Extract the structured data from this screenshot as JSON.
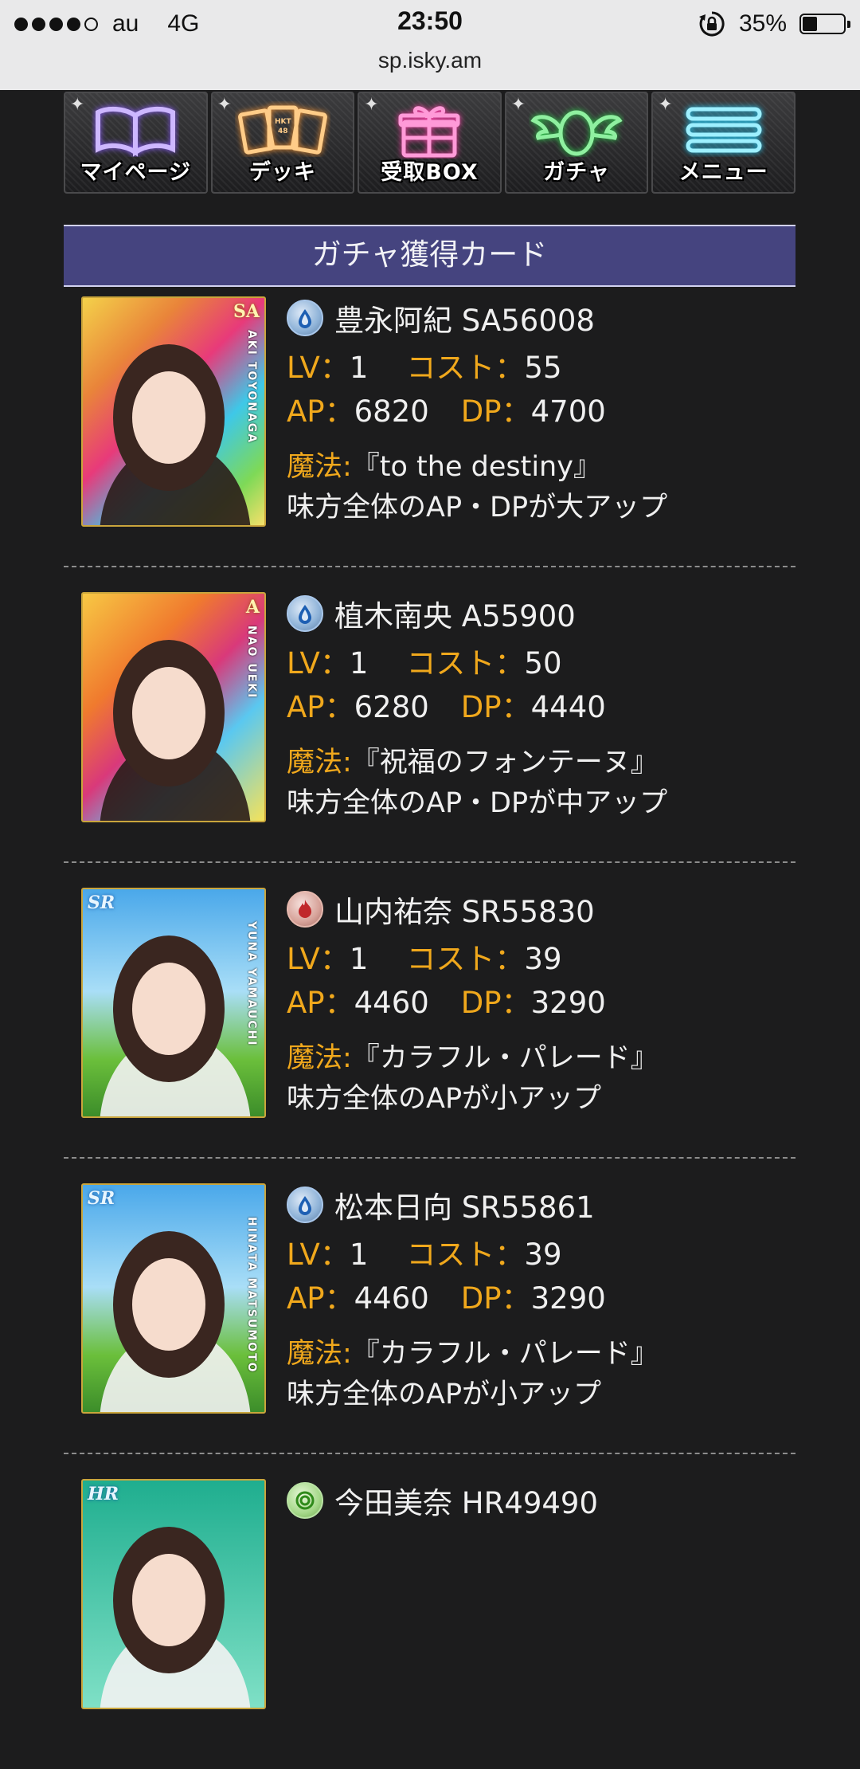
{
  "status_bar": {
    "carrier": "au",
    "network": "4G",
    "time": "23:50",
    "battery_percent": "35%",
    "battery_level": 0.35
  },
  "url_bar": {
    "url": "sp.isky.am"
  },
  "nav": [
    {
      "label": "マイページ",
      "icon": "book-icon",
      "color": "#cdb7ff"
    },
    {
      "label": "デッキ",
      "icon": "cards-icon",
      "color": "#ffcc88"
    },
    {
      "label": "受取BOX",
      "icon": "gift-box-icon",
      "color": "#ff9ad8"
    },
    {
      "label": "ガチャ",
      "icon": "winged-egg-icon",
      "color": "#8ff0a0"
    },
    {
      "label": "メニュー",
      "icon": "menu-icon",
      "color": "#9ef0ff"
    }
  ],
  "section": {
    "title": "ガチャ獲得カード"
  },
  "labels": {
    "lv": "LV：",
    "cost": "コスト：",
    "ap": "AP：",
    "dp": "DP：",
    "magic": "魔法:"
  },
  "cards": [
    {
      "attribute": "water",
      "name": "豊永阿紀 SA56008",
      "lv": "1",
      "cost": "55",
      "ap": "6820",
      "dp": "4700",
      "magic": "『to the destiny』",
      "desc": "味方全体のAP・DPが大アップ",
      "rarity_mark": "SA",
      "card_name_vertical": "AKI TOYONAGA"
    },
    {
      "attribute": "water",
      "name": "植木南央 A55900",
      "lv": "1",
      "cost": "50",
      "ap": "6280",
      "dp": "4440",
      "magic": "『祝福のフォンテーヌ』",
      "desc": "味方全体のAP・DPが中アップ",
      "rarity_mark": "A",
      "card_name_vertical": "NAO UEKI"
    },
    {
      "attribute": "fire",
      "name": "山内祐奈 SR55830",
      "lv": "1",
      "cost": "39",
      "ap": "4460",
      "dp": "3290",
      "magic": "『カラフル・パレード』",
      "desc": "味方全体のAPが小アップ",
      "rarity_mark": "SR",
      "card_name_vertical": "YUNA YAMAUCHI"
    },
    {
      "attribute": "water",
      "name": "松本日向 SR55861",
      "lv": "1",
      "cost": "39",
      "ap": "4460",
      "dp": "3290",
      "magic": "『カラフル・パレード』",
      "desc": "味方全体のAPが小アップ",
      "rarity_mark": "SR",
      "card_name_vertical": "HINATA MATSUMOTO"
    },
    {
      "attribute": "wind",
      "name": "今田美奈 HR49490",
      "rarity_mark": "HR"
    }
  ]
}
